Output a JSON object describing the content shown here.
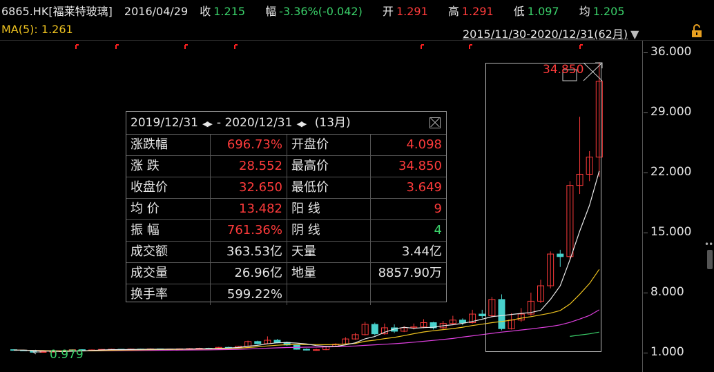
{
  "header": {
    "symbol": "6865.HK[福莱特玻璃]",
    "date": "2016/04/29",
    "close_label": "收",
    "close": "1.215",
    "change_label": "幅",
    "change": "-3.36%(-0.042)",
    "open_label": "开",
    "open": "1.291",
    "high_label": "高",
    "high": "1.291",
    "low_label": "低",
    "low": "1.097",
    "avg_label": "均",
    "avg": "1.205"
  },
  "ma_text": "MA(5): 1.261",
  "range_text": "2015/11/30-2020/12/31(62月)",
  "axis_ticks": [
    "36.000",
    "29.000",
    "22.000",
    "15.000",
    "8.000",
    "1.000"
  ],
  "high_marker": "34.850",
  "low_marker": "0.979",
  "panel": {
    "start": "2019/12/31",
    "end": "2020/12/31",
    "span": "(13月)",
    "rows": [
      [
        "涨跌幅",
        "696.73%",
        "开盘价",
        "4.098"
      ],
      [
        "涨 跌",
        "28.552",
        "最高价",
        "34.850"
      ],
      [
        "收盘价",
        "32.650",
        "最低价",
        "3.649"
      ],
      [
        "均 价",
        "13.482",
        "阳 线",
        "9"
      ],
      [
        "振 幅",
        "761.36%",
        "阴 线",
        "4"
      ],
      [
        "成交额",
        "363.53亿",
        "天量",
        "3.44亿"
      ],
      [
        "成交量",
        "26.96亿",
        "地量",
        "8857.90万"
      ],
      [
        "换手率",
        "599.22%",
        "",
        ""
      ]
    ],
    "value_colors": [
      [
        "#ff3b3b",
        "#ff3b3b"
      ],
      [
        "#ff3b3b",
        "#ff3b3b"
      ],
      [
        "#ff3b3b",
        "#ff3b3b"
      ],
      [
        "#ff3b3b",
        "#ff3b3b"
      ],
      [
        "#ff3b3b",
        "#3ad16a"
      ],
      [
        "#e6e6e6",
        "#e6e6e6"
      ],
      [
        "#e6e6e6",
        "#e6e6e6"
      ],
      [
        "#e6e6e6",
        "#e6e6e6"
      ]
    ]
  },
  "chart_data": {
    "type": "candlestick",
    "ylim": [
      1,
      36
    ],
    "yticks": [
      36,
      29,
      22,
      15,
      8,
      1
    ],
    "candles": [
      [
        1.35,
        1.3,
        1.4,
        1.25
      ],
      [
        1.3,
        1.28,
        1.35,
        1.22
      ],
      [
        1.28,
        1.05,
        1.3,
        0.98
      ],
      [
        1.05,
        1.12,
        1.18,
        1.0
      ],
      [
        1.12,
        1.15,
        1.2,
        1.08
      ],
      [
        1.15,
        1.2,
        1.25,
        1.1
      ],
      [
        1.2,
        1.35,
        1.4,
        1.18
      ],
      [
        1.35,
        1.3,
        1.4,
        1.25
      ],
      [
        1.3,
        1.32,
        1.38,
        1.26
      ],
      [
        1.32,
        1.38,
        1.42,
        1.28
      ],
      [
        1.38,
        1.4,
        1.46,
        1.34
      ],
      [
        1.4,
        1.36,
        1.44,
        1.3
      ],
      [
        1.36,
        1.42,
        1.48,
        1.32
      ],
      [
        1.42,
        1.4,
        1.46,
        1.36
      ],
      [
        1.4,
        1.44,
        1.5,
        1.36
      ],
      [
        1.44,
        1.38,
        1.48,
        1.32
      ],
      [
        1.38,
        1.42,
        1.46,
        1.34
      ],
      [
        1.42,
        1.45,
        1.5,
        1.38
      ],
      [
        1.45,
        1.48,
        1.55,
        1.4
      ],
      [
        1.48,
        1.52,
        1.58,
        1.44
      ],
      [
        1.52,
        1.5,
        1.58,
        1.46
      ],
      [
        1.5,
        1.62,
        1.68,
        1.48
      ],
      [
        1.62,
        1.6,
        1.7,
        1.55
      ],
      [
        1.6,
        1.75,
        1.8,
        1.58
      ],
      [
        1.75,
        2.3,
        2.4,
        1.72
      ],
      [
        2.3,
        2.05,
        2.4,
        1.95
      ],
      [
        2.05,
        2.45,
        2.9,
        2.0
      ],
      [
        2.45,
        2.2,
        2.6,
        2.1
      ],
      [
        2.2,
        1.9,
        2.3,
        1.8
      ],
      [
        1.9,
        1.4,
        1.95,
        1.35
      ],
      [
        1.4,
        1.3,
        1.5,
        1.25
      ],
      [
        1.3,
        1.35,
        1.45,
        1.22
      ],
      [
        1.35,
        1.7,
        1.8,
        1.3
      ],
      [
        1.7,
        2.0,
        2.1,
        1.65
      ],
      [
        2.0,
        2.6,
        2.8,
        1.95
      ],
      [
        2.6,
        3.1,
        3.3,
        2.5
      ],
      [
        3.1,
        4.3,
        4.6,
        3.0
      ],
      [
        4.3,
        3.2,
        4.5,
        3.0
      ],
      [
        3.2,
        3.9,
        4.4,
        3.1
      ],
      [
        3.9,
        3.5,
        4.3,
        3.3
      ],
      [
        3.5,
        3.9,
        4.1,
        3.4
      ],
      [
        3.9,
        4.0,
        4.4,
        3.7
      ],
      [
        4.0,
        4.5,
        4.9,
        3.85
      ],
      [
        4.5,
        3.9,
        4.6,
        3.7
      ],
      [
        3.9,
        4.4,
        4.7,
        3.7
      ],
      [
        4.4,
        4.8,
        5.3,
        4.2
      ],
      [
        4.8,
        4.5,
        5.0,
        4.2
      ],
      [
        4.5,
        5.5,
        6.0,
        4.4
      ],
      [
        5.5,
        5.3,
        6.0,
        5.0
      ],
      [
        5.3,
        7.2,
        7.5,
        5.1
      ],
      [
        7.2,
        3.8,
        7.8,
        3.6
      ],
      [
        3.8,
        4.8,
        5.6,
        3.7
      ],
      [
        4.8,
        5.5,
        6.2,
        4.6
      ],
      [
        5.5,
        7.0,
        8.0,
        5.3
      ],
      [
        7.0,
        8.8,
        9.5,
        6.8
      ],
      [
        8.8,
        12.5,
        12.8,
        8.5
      ],
      [
        12.5,
        12.2,
        13.0,
        11.0
      ],
      [
        12.2,
        20.5,
        21.0,
        11.8
      ],
      [
        20.5,
        21.8,
        28.5,
        19.5
      ],
      [
        21.8,
        23.8,
        24.5,
        21.0
      ],
      [
        23.8,
        32.65,
        34.85,
        21.5
      ]
    ],
    "ma5": [
      1.3,
      1.29,
      1.23,
      1.19,
      1.17,
      1.14,
      1.17,
      1.22,
      1.26,
      1.31,
      1.35,
      1.35,
      1.37,
      1.39,
      1.4,
      1.4,
      1.41,
      1.42,
      1.43,
      1.45,
      1.47,
      1.51,
      1.55,
      1.6,
      1.76,
      1.86,
      2.03,
      2.15,
      2.18,
      2.12,
      2.02,
      1.83,
      1.73,
      1.73,
      1.91,
      2.15,
      2.62,
      2.88,
      3.38,
      3.76,
      3.96,
      3.84,
      3.92,
      3.96,
      4.14,
      4.26,
      4.42,
      4.64,
      4.9,
      5.2,
      5.32,
      5.46,
      5.58,
      5.68,
      5.94,
      7.22,
      8.8,
      11.84,
      15.16,
      18.18,
      22.18
    ],
    "ma10": [
      1.3,
      1.29,
      1.26,
      1.24,
      1.22,
      1.2,
      1.2,
      1.2,
      1.21,
      1.24,
      1.27,
      1.29,
      1.31,
      1.33,
      1.35,
      1.37,
      1.38,
      1.39,
      1.41,
      1.42,
      1.43,
      1.45,
      1.48,
      1.52,
      1.6,
      1.68,
      1.79,
      1.87,
      1.93,
      1.95,
      1.96,
      1.94,
      1.93,
      1.94,
      2.01,
      2.08,
      2.33,
      2.46,
      2.63,
      2.78,
      2.99,
      3.21,
      3.41,
      3.56,
      3.69,
      3.81,
      3.97,
      4.16,
      4.32,
      4.5,
      4.64,
      4.8,
      5.02,
      5.2,
      5.4,
      5.61,
      5.92,
      6.67,
      7.81,
      9.06,
      10.71
    ],
    "ma20": [
      1.3,
      1.29,
      1.26,
      1.24,
      1.22,
      1.2,
      1.2,
      1.2,
      1.21,
      1.22,
      1.23,
      1.24,
      1.25,
      1.26,
      1.27,
      1.28,
      1.29,
      1.3,
      1.31,
      1.32,
      1.33,
      1.35,
      1.37,
      1.39,
      1.43,
      1.47,
      1.52,
      1.56,
      1.6,
      1.62,
      1.64,
      1.65,
      1.67,
      1.69,
      1.73,
      1.78,
      1.85,
      1.92,
      1.98,
      2.05,
      2.13,
      2.22,
      2.33,
      2.43,
      2.54,
      2.66,
      2.82,
      2.96,
      3.11,
      3.25,
      3.4,
      3.51,
      3.65,
      3.77,
      3.91,
      4.05,
      4.24,
      4.53,
      4.92,
      5.34,
      6.0
    ],
    "ma60": [
      null,
      null,
      null,
      null,
      null,
      null,
      null,
      null,
      null,
      null,
      null,
      null,
      null,
      null,
      null,
      null,
      null,
      null,
      null,
      null,
      null,
      null,
      null,
      null,
      null,
      null,
      null,
      null,
      null,
      null,
      null,
      null,
      null,
      null,
      null,
      null,
      null,
      null,
      null,
      null,
      null,
      null,
      null,
      null,
      null,
      null,
      null,
      null,
      null,
      null,
      null,
      null,
      null,
      null,
      null,
      null,
      null,
      2.9,
      3.05,
      3.2,
      3.4
    ]
  },
  "colors": {
    "up": "#ff3b3b",
    "down": "#48d1cc",
    "ma5": "#e8e8e8",
    "ma10": "#f0c420",
    "ma20": "#e040e0",
    "ma60": "#3ad16a"
  }
}
